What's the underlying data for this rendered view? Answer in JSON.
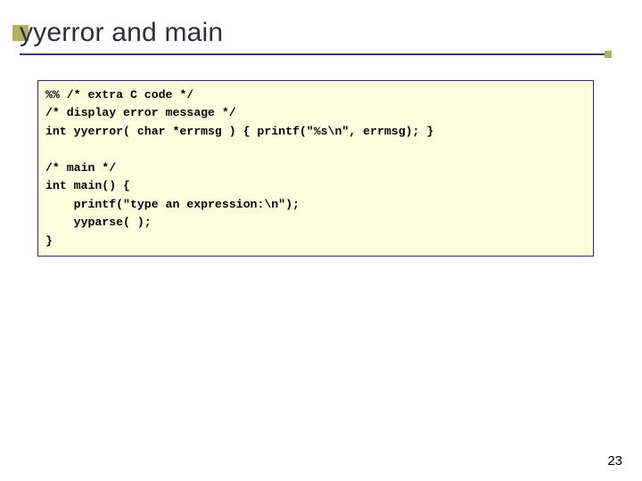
{
  "slide": {
    "title": "yyerror and main",
    "page_number": "23"
  },
  "code": {
    "block": "%% /* extra C code */\n/* display error message */\nint yyerror( char *errmsg ) { printf(\"%s\\n\", errmsg); }\n\n/* main */\nint main() {\n    printf(\"type an expression:\\n\");\n    yyparse( );\n}"
  }
}
